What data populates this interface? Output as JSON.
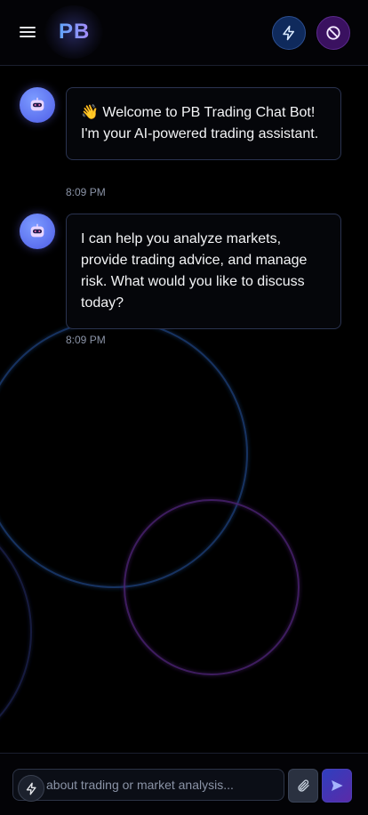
{
  "header": {
    "logo": "PB",
    "menu_icon": "hamburger-menu-icon",
    "quick_action_icon": "lightning-bolt-icon",
    "stop_icon": "ban-icon"
  },
  "messages": [
    {
      "sender": "bot",
      "avatar_icon": "robot-icon",
      "emoji": "👋",
      "text": "Welcome to PB Trading Chat Bot! I'm your AI-powered trading assistant.",
      "time": "8:09 PM"
    },
    {
      "sender": "bot",
      "avatar_icon": "robot-icon",
      "text": "I can help you analyze markets, provide trading advice, and manage risk. What would you like to discuss today?",
      "time": "8:09 PM"
    }
  ],
  "composer": {
    "placeholder": "about trading or market analysis...",
    "value": "",
    "quick_icon": "lightning-bolt-icon",
    "attach_icon": "paperclip-icon",
    "send_icon": "send-icon"
  },
  "colors": {
    "background": "#000000",
    "accent_blue": "#3b82f6",
    "accent_purple": "#8b5cf6"
  }
}
